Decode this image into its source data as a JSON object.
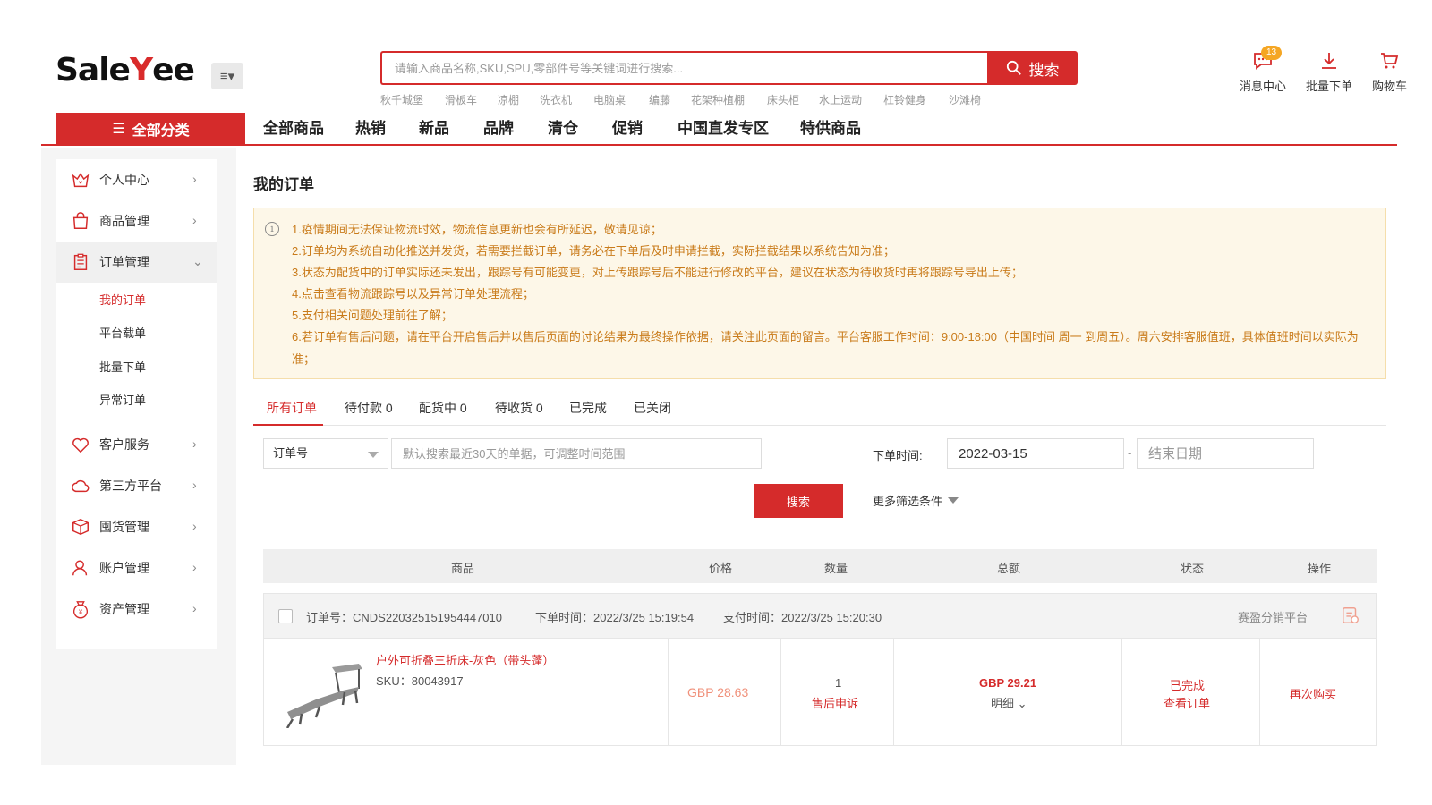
{
  "header": {
    "logo_part1": "Sale",
    "logo_part2": "Y",
    "logo_part3": "ee",
    "search_placeholder": "请输入商品名称,SKU,SPU,零部件号等关键词进行搜索...",
    "search_button": "搜索",
    "hot_words": [
      "秋千城堡",
      "滑板车",
      "凉棚",
      "洗衣机",
      "电脑桌",
      "编藤",
      "花架种植棚",
      "床头柜",
      "水上运动",
      "杠铃健身",
      "沙滩椅"
    ],
    "icons": {
      "messages_label": "消息中心",
      "messages_badge": "13",
      "bulk_order_label": "批量下单",
      "cart_label": "购物车"
    }
  },
  "nav": {
    "all_categories": "全部分类",
    "items": [
      "全部商品",
      "热销",
      "新品",
      "品牌",
      "清仓",
      "促销",
      "中国直发专区",
      "特供商品"
    ]
  },
  "sidebar": {
    "items": [
      {
        "label": "个人中心",
        "icon": "crown-icon"
      },
      {
        "label": "商品管理",
        "icon": "bag-icon"
      },
      {
        "label": "订单管理",
        "icon": "clipboard-icon"
      },
      {
        "label": "客户服务",
        "icon": "heart-icon"
      },
      {
        "label": "第三方平台",
        "icon": "cloud-icon"
      },
      {
        "label": "囤货管理",
        "icon": "box-icon"
      },
      {
        "label": "账户管理",
        "icon": "user-icon"
      },
      {
        "label": "资产管理",
        "icon": "money-bag-icon"
      }
    ],
    "sub_items": [
      "我的订单",
      "平台载单",
      "批量下单",
      "异常订单"
    ]
  },
  "main": {
    "title": "我的订单",
    "notices": [
      "1.疫情期间无法保证物流时效，物流信息更新也会有所延迟，敬请见谅；",
      "2.订单均为系统自动化推送并发货，若需要拦截订单，请务必在下单后及时申请拦截，实际拦截结果以系统告知为准；",
      "3.状态为配货中的订单实际还未发出，跟踪号有可能变更，对上传跟踪号后不能进行修改的平台，建议在状态为待收货时再将跟踪号导出上传；",
      "4.点击查看物流跟踪号以及异常订单处理流程；",
      "5.支付相关问题处理前往了解；",
      "6.若订单有售后问题，请在平台开启售后并以售后页面的讨论结果为最终操作依据，请关注此页面的留言。平台客服工作时间：9:00-18:00（中国时间 周一 到周五）。周六安排客服值班，具体值班时间以实际为准；"
    ],
    "tabs": [
      "所有订单",
      "待付款 0",
      "配货中 0",
      "待收货 0",
      "已完成",
      "已关闭"
    ],
    "filter": {
      "type_select": "订单号",
      "keyword_placeholder": "默认搜索最近30天的单据，可调整时间范围",
      "date_label": "下单时间:",
      "start_date": "2022-03-15",
      "date_separator": "-",
      "end_date_placeholder": "结束日期",
      "search_button": "搜索",
      "more_filters": "更多筛选条件"
    },
    "table_headers": [
      "商品",
      "价格",
      "数量",
      "总额",
      "状态",
      "操作"
    ],
    "order": {
      "order_no": "订单号：CNDS220325151954447010",
      "order_time": "下单时间：2022/3/25 15:19:54",
      "pay_time": "支付时间：2022/3/25 15:20:30",
      "platform": "赛盈分销平台",
      "product_name": "户外可折叠三折床-灰色（带头蓬）",
      "sku": "SKU：80043917",
      "price": "GBP 28.63",
      "quantity": "1",
      "after_sale": "售后申诉",
      "total": "GBP 29.21",
      "detail": "明细",
      "status": "已完成",
      "view_order": "查看订单",
      "rebuy": "再次购买"
    }
  },
  "colors": {
    "brand_red": "#d52b2b",
    "notice_bg": "#fdf7e8",
    "notice_text": "#c97b1a"
  }
}
